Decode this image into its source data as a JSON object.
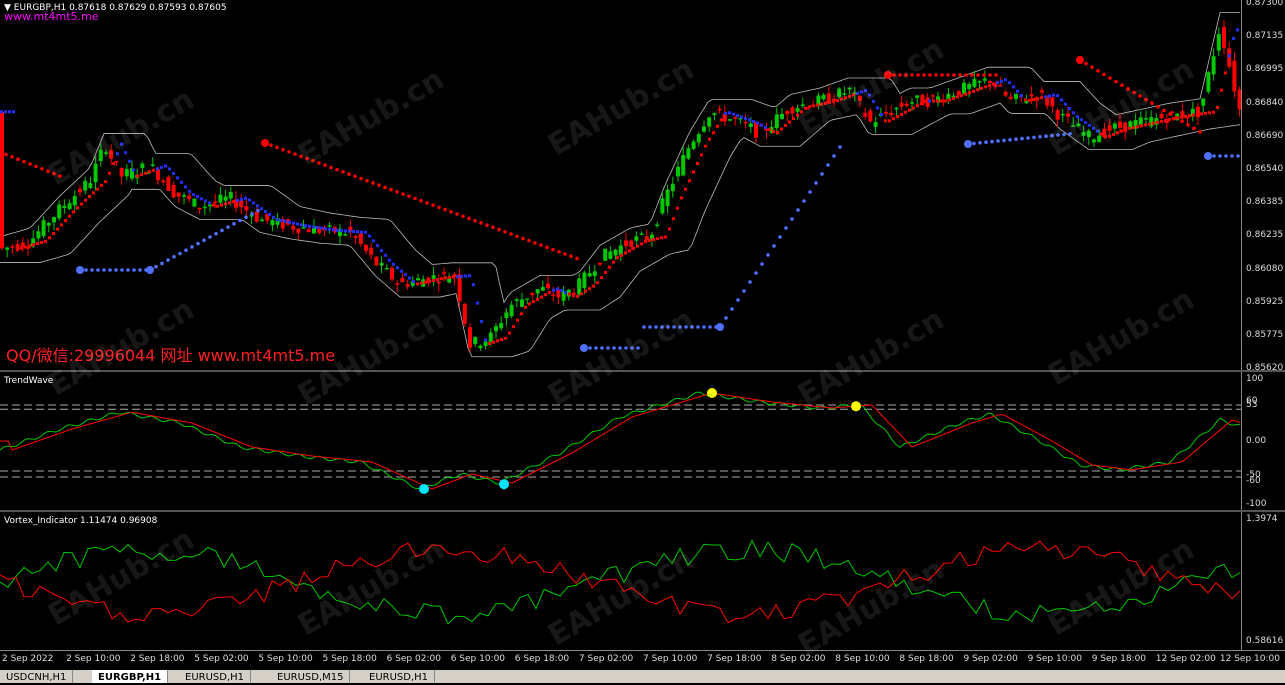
{
  "main_chart": {
    "title": "EURGBP,H1  0.87618 0.87629 0.87593 0.87605",
    "site_tag": "www.mt4mt5.me",
    "promo": "QQ/微信:29996044 网址 www.mt4mt5.me",
    "price_labels": [
      "0.87300",
      "0.87135",
      "0.86995",
      "0.86840",
      "0.86690",
      "0.86540",
      "0.86385",
      "0.86235",
      "0.86080",
      "0.85925",
      "0.85775",
      "0.85620"
    ]
  },
  "trendwave": {
    "name": "TrendWave",
    "levels": [
      "100",
      "60",
      "53",
      "0.00",
      "-50",
      "-60",
      "-100"
    ]
  },
  "vortex": {
    "name": "Vortex_Indicator 1.11474 0.96908",
    "levels": [
      "1.3974",
      "0.58616"
    ]
  },
  "time_labels": [
    "2 Sep 2022",
    "2 Sep 10:00",
    "2 Sep 18:00",
    "5 Sep 02:00",
    "5 Sep 10:00",
    "5 Sep 18:00",
    "6 Sep 02:00",
    "6 Sep 10:00",
    "6 Sep 18:00",
    "7 Sep 02:00",
    "7 Sep 10:00",
    "7 Sep 18:00",
    "8 Sep 02:00",
    "8 Sep 10:00",
    "8 Sep 18:00",
    "9 Sep 02:00",
    "9 Sep 10:00",
    "9 Sep 18:00",
    "12 Sep 02:00",
    "12 Sep 10:00"
  ],
  "tabs": [
    "USDCNH,H1",
    "EURGBP,H1",
    "EURUSD,H1",
    "EURUSD,M15",
    "EURUSD,H1"
  ],
  "watermark": "EAHub.cn",
  "colors": {
    "bull": "#00c800",
    "bear": "#ff0000",
    "blue": "#2030ff",
    "dot_blue": "#5070ff",
    "cyan": "#00e5ff",
    "yellow": "#ffff00"
  }
}
